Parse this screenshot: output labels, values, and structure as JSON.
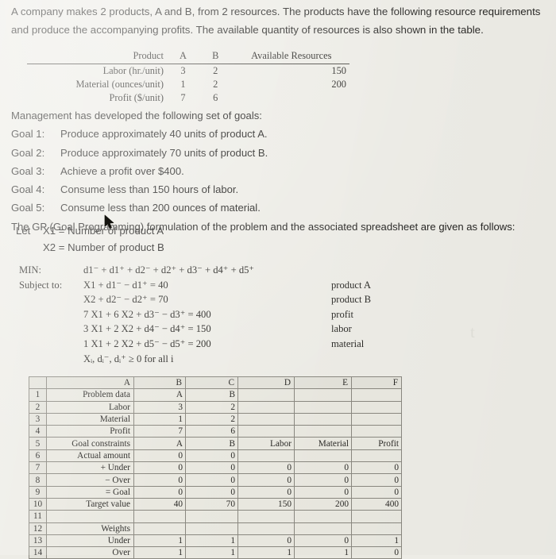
{
  "intro": {
    "paragraph": "A company makes 2 products, A and B, from 2 resources. The products have the following resource requirements and produce the accompanying profits. The available quantity of resources is also shown in the table."
  },
  "resource_table": {
    "headers": [
      "Product",
      "A",
      "B",
      "Available Resources"
    ],
    "rows": [
      {
        "name": "Labor (hr./unit)",
        "a": "3",
        "b": "2",
        "available": "150"
      },
      {
        "name": "Material (ounces/unit)",
        "a": "1",
        "b": "2",
        "available": "200"
      },
      {
        "name": "Profit ($/unit)",
        "a": "7",
        "b": "6",
        "available": ""
      }
    ]
  },
  "goals": {
    "lead": "Management has developed the following set of goals:",
    "items": [
      {
        "label": "Goal 1:",
        "text": "Produce approximately 40 units of product A."
      },
      {
        "label": "Goal 2:",
        "text": "Produce approximately 70 units of product B."
      },
      {
        "label": "Goal 3:",
        "text": "Achieve a profit over $400."
      },
      {
        "label": "Goal 4:",
        "text": "Consume less than 150 hours of labor."
      },
      {
        "label": "Goal 5:",
        "text": "Consume less than 200 ounces of material."
      }
    ],
    "tail": "The GP (Goal Programming) formulation of the problem and the associated spreadsheet are given as follows:"
  },
  "definitions": {
    "lead": "Let",
    "x1": "X1 = Number of product A",
    "x2": "X2 = Number of product B"
  },
  "formulation": {
    "min_label": "MIN:",
    "subject_label": "Subject to:",
    "objective": "d1⁻ + d1⁺ + d2⁻ + d2⁺ + d3⁻ + d4⁺ + d5⁺",
    "constraints": [
      {
        "expr": "X1 + d1⁻ − d1⁺ = 40",
        "note": "product A"
      },
      {
        "expr": "X2 + d2⁻ − d2⁺ = 70",
        "note": "product B"
      },
      {
        "expr": "7 X1 + 6 X2 + d3⁻ − d3⁺ = 400",
        "note": "profit"
      },
      {
        "expr": "3 X1 + 2 X2 + d4⁻ − d4⁺ = 150",
        "note": "labor"
      },
      {
        "expr": "1 X1 + 2 X2 + d5⁻ − d5⁺ = 200",
        "note": "material"
      }
    ],
    "nonnegativity": "Xᵢ, dᵢ⁻, dᵢ⁺ ≥ 0 for all i"
  },
  "spreadsheet": {
    "column_headers": [
      "A",
      "B",
      "C",
      "D",
      "E",
      "F"
    ],
    "rows": [
      {
        "num": "1",
        "cells": [
          "Problem data",
          "A",
          "B",
          "",
          "",
          ""
        ]
      },
      {
        "num": "2",
        "cells": [
          "Labor",
          "3",
          "2",
          "",
          "",
          ""
        ]
      },
      {
        "num": "3",
        "cells": [
          "Material",
          "1",
          "2",
          "",
          "",
          ""
        ]
      },
      {
        "num": "4",
        "cells": [
          "Profit",
          "7",
          "6",
          "",
          "",
          ""
        ]
      },
      {
        "num": "5",
        "cells": [
          "Goal constraints",
          "A",
          "B",
          "Labor",
          "Material",
          "Profit"
        ]
      },
      {
        "num": "6",
        "cells": [
          "Actual amount",
          "0",
          "0",
          "",
          "",
          ""
        ]
      },
      {
        "num": "7",
        "cells": [
          "+ Under",
          "0",
          "0",
          "0",
          "0",
          "0"
        ]
      },
      {
        "num": "8",
        "cells": [
          "− Over",
          "0",
          "0",
          "0",
          "0",
          "0"
        ]
      },
      {
        "num": "9",
        "cells": [
          "= Goal",
          "0",
          "0",
          "0",
          "0",
          "0"
        ]
      },
      {
        "num": "10",
        "cells": [
          "Target value",
          "40",
          "70",
          "150",
          "200",
          "400"
        ]
      },
      {
        "num": "11",
        "cells": [
          "",
          "",
          "",
          "",
          "",
          ""
        ]
      },
      {
        "num": "12",
        "cells": [
          "Weights",
          "",
          "",
          "",
          "",
          ""
        ]
      },
      {
        "num": "13",
        "cells": [
          "Under",
          "1",
          "1",
          "0",
          "0",
          "1"
        ]
      },
      {
        "num": "14",
        "cells": [
          "Over",
          "1",
          "1",
          "1",
          "1",
          "0"
        ]
      }
    ]
  },
  "watermark": {
    "text": "t"
  },
  "colors": {
    "page_background": "#edece6",
    "text": "#262523",
    "grid_line": "#8a8880"
  }
}
